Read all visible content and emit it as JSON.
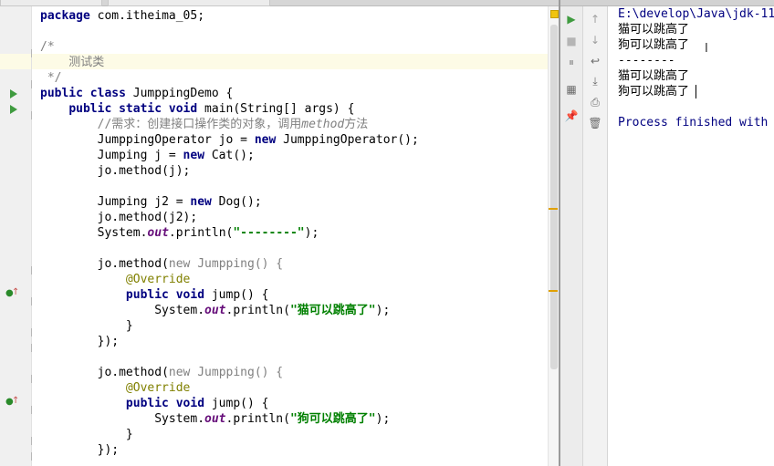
{
  "editor": {
    "lines": [
      "package com.itheima_05;",
      "",
      "/*",
      "    测试类",
      " */",
      "public class JumppingDemo {",
      "    public static void main(String[] args) {",
      "        //需求：创建接口操作类的对象，调用method方法",
      "        JumppingOperator jo = new JumppingOperator();",
      "        Jumping j = new Cat();",
      "        jo.method(j);",
      "",
      "        Jumping j2 = new Dog();",
      "        jo.method(j2);",
      "        System.out.println(\"--------\");",
      "",
      "        jo.method(new Jumpping() {",
      "            @Override",
      "            public void jump() {",
      "                System.out.println(\"猫可以跳高了\");",
      "            }",
      "        });",
      "",
      "        jo.method(new Jumpping() {",
      "            @Override",
      "            public void jump() {",
      "                System.out.println(\"狗可以跳高了\");",
      "            }",
      "        });"
    ],
    "tokens": {
      "package_kw": "package",
      "package_name": " com.itheima_05;",
      "comment_open": "/*",
      "comment_body": "    测试类",
      "comment_close": " */",
      "public_kw": "public",
      "class_kw": "class",
      "class_name": " JumppingDemo {",
      "static_kw": "static",
      "void_kw": "void",
      "main_sig": " main(String[] args) {",
      "line_comment_a": "//需求：创建接口操作类的对象，调用",
      "line_comment_method": "method",
      "line_comment_b": "方法",
      "jo_decl_a": "JumppingOperator jo = ",
      "new_kw": "new",
      "jo_decl_b": " JumppingOperator();",
      "j_decl_a": "Jumping j = ",
      "j_decl_b": " Cat();",
      "jo_method_j": "jo.method(j);",
      "j2_decl_a": "Jumping j2 = ",
      "j2_decl_b": " Dog();",
      "jo_method_j2": "jo.method(j2);",
      "println_a": "System.",
      "out_field": "out",
      "println_b": ".println(",
      "dash_string": "\"--------\"",
      "println_end": ");",
      "anon_a": "jo.method(",
      "anon_type": " Jumpping() {",
      "override_ann": "@Override",
      "jump_sig": " jump() {",
      "cat_string": "\"猫可以跳高了\"",
      "dog_string": "\"狗可以跳高了\"",
      "close_brace": "}",
      "close_call": "});"
    }
  },
  "run_panel": {
    "lines": [
      "E:\\develop\\Java\\jdk-11",
      "猫可以跳高了",
      "狗可以跳高了",
      "--------",
      "猫可以跳高了",
      "狗可以跳高了",
      "",
      "Process finished with"
    ]
  },
  "colors": {
    "keyword": "#000080",
    "string": "#008000",
    "comment": "#808080",
    "annotation": "#808000",
    "static_field": "#660e7a",
    "run_green": "#3f9b3f"
  }
}
